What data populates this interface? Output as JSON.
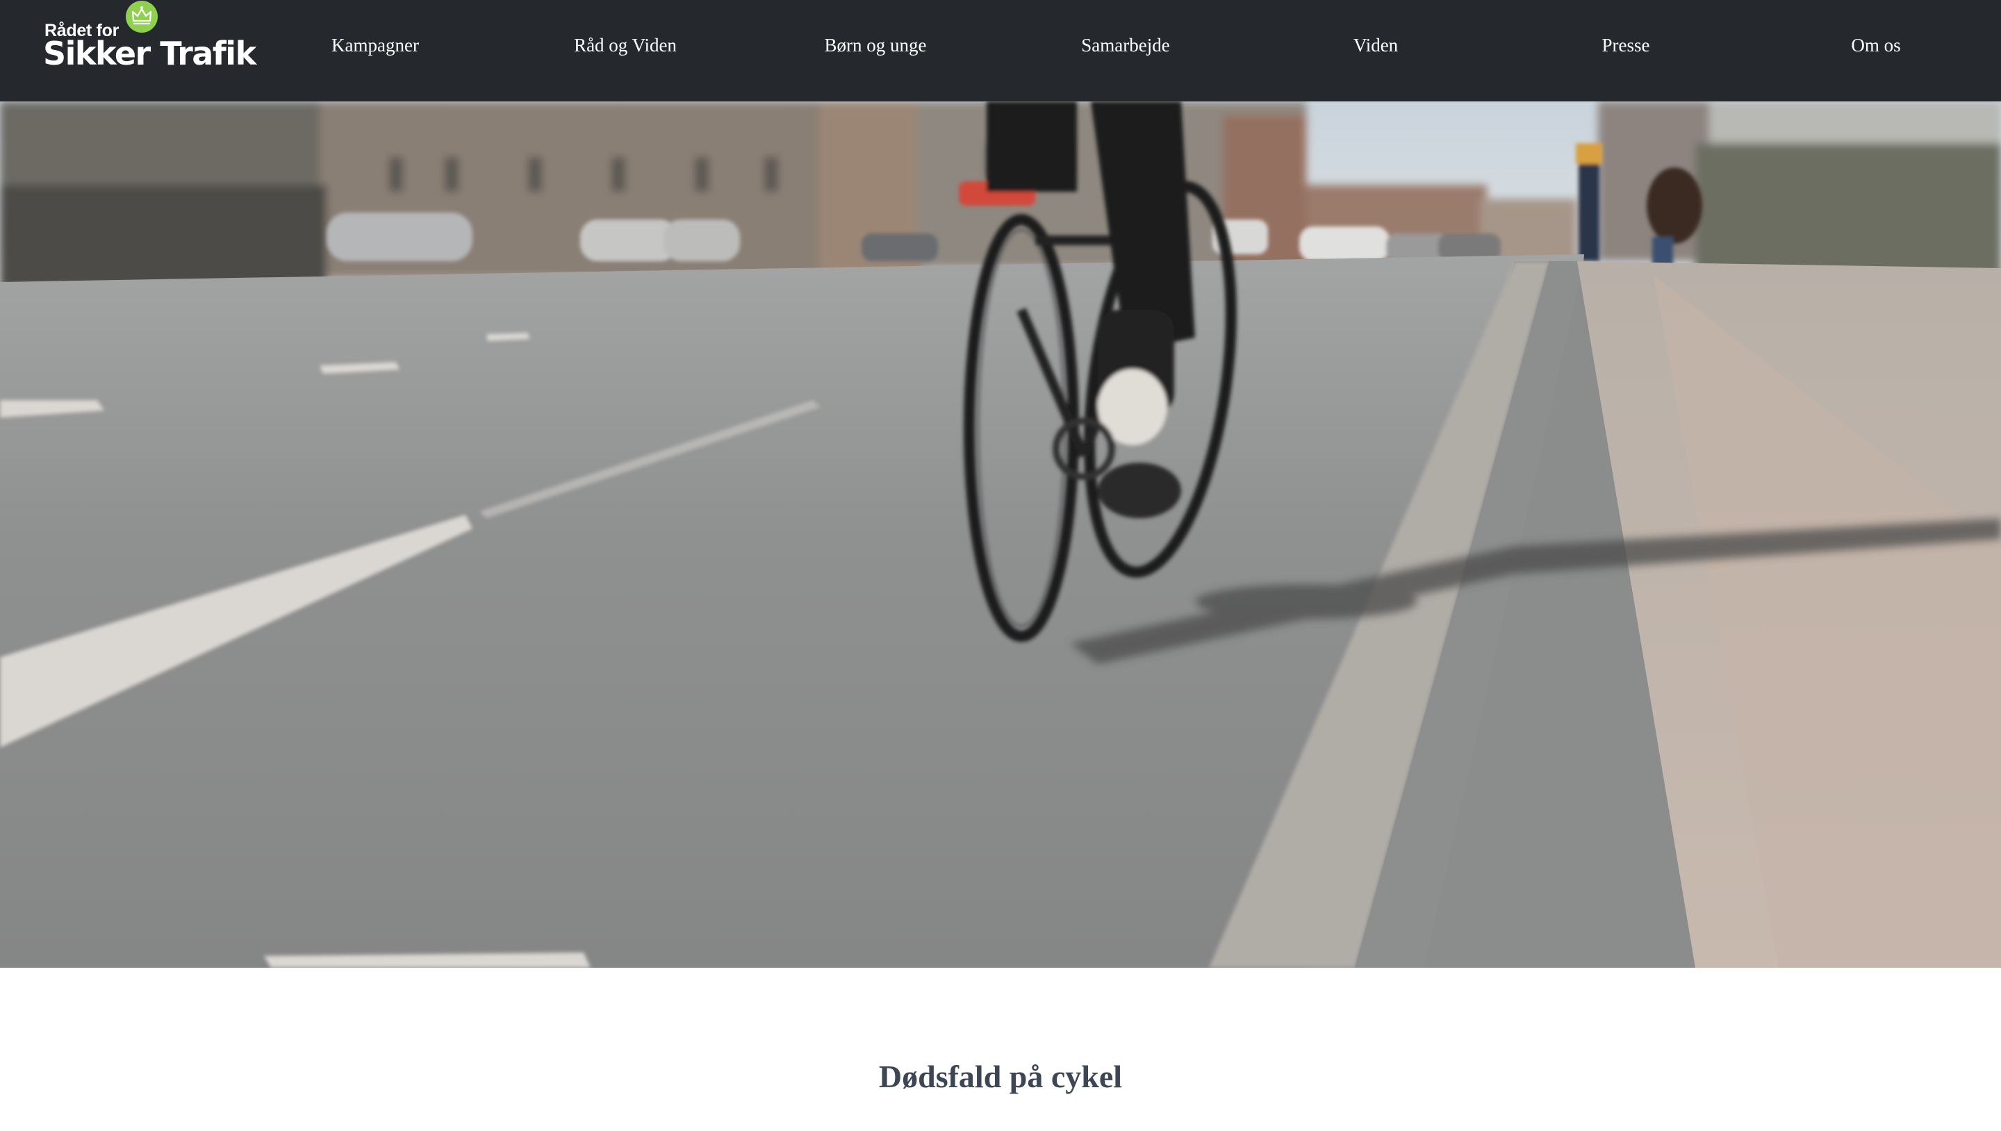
{
  "logo": {
    "line1": "Rådet for",
    "line2": "Sikker Trafik",
    "accent_color": "#8fd14f"
  },
  "nav": {
    "items": [
      {
        "label": "Kampagner"
      },
      {
        "label": "Råd og Viden"
      },
      {
        "label": "Børn og unge"
      },
      {
        "label": "Samarbejde"
      },
      {
        "label": "Viden"
      },
      {
        "label": "Presse"
      },
      {
        "label": "Om os"
      }
    ]
  },
  "hero": {
    "image_alt": "cyclist-on-bike-lane-photo"
  },
  "main": {
    "title": "Dødsfald på cykel"
  },
  "colors": {
    "header_bg": "#25282d",
    "title_text": "#3d4654"
  }
}
